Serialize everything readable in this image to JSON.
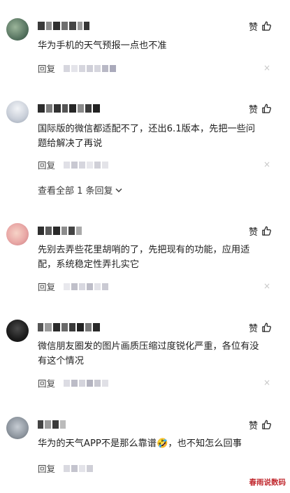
{
  "like_label": "赞",
  "reply_label": "回复",
  "close_symbol": "×",
  "view_all": {
    "label": "查看全部 1 条回复"
  },
  "comments": [
    {
      "text": "华为手机的天气预报一点也不准"
    },
    {
      "text": "国际版的微信都适配不了，还出6.1版本，先把一些问题给解决了再说"
    },
    {
      "text": "先别去弄些花里胡哨的了，先把现有的功能，应用适配，系统稳定性弄扎实它"
    },
    {
      "text": "微信朋友圈发的图片画质压缩过度锐化严重，各位有没有这个情况"
    },
    {
      "text": "华为的天气APP不是那么靠谱🤣，也不知怎么回事"
    }
  ],
  "watermark": "春雨说数码",
  "colors": {
    "text": "#1f1f1f",
    "meta": "#444444",
    "watermark": "#c0272d"
  }
}
